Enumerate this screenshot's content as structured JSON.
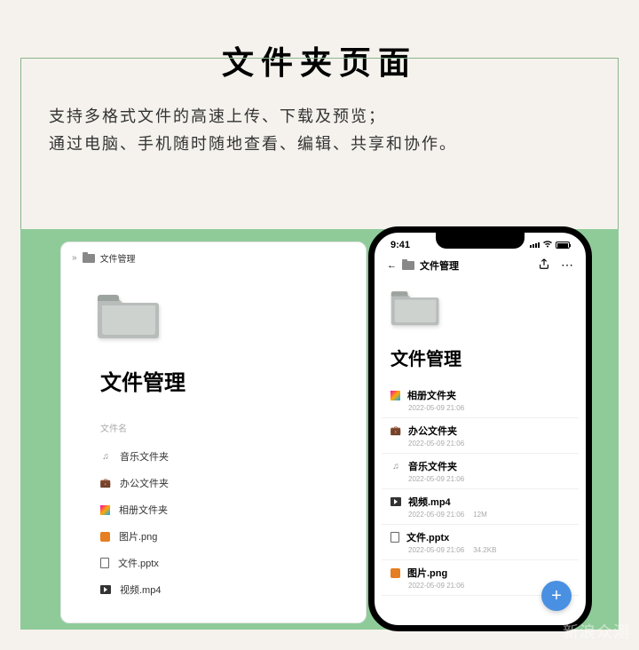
{
  "page_title": "文件夹页面",
  "subtitle_line1": "支持多格式文件的高速上传、下载及预览；",
  "subtitle_line2": "通过电脑、手机随时随地查看、编辑、共享和协作。",
  "desktop": {
    "breadcrumb_icon": "folder",
    "breadcrumb": "文件管理",
    "title": "文件管理",
    "column_header": "文件名",
    "items": [
      {
        "icon": "music",
        "name": "音乐文件夹"
      },
      {
        "icon": "briefcase",
        "name": "办公文件夹"
      },
      {
        "icon": "album",
        "name": "相册文件夹"
      },
      {
        "icon": "img",
        "name": "图片.png"
      },
      {
        "icon": "file",
        "name": "文件.pptx"
      },
      {
        "icon": "video",
        "name": "视频.mp4"
      }
    ]
  },
  "phone": {
    "status_time": "9:41",
    "breadcrumb": "文件管理",
    "title": "文件管理",
    "items": [
      {
        "icon": "album",
        "name": "相册文件夹",
        "date": "2022-05-09 21:06",
        "size": ""
      },
      {
        "icon": "briefcase",
        "name": "办公文件夹",
        "date": "2022-05-09 21:06",
        "size": ""
      },
      {
        "icon": "music",
        "name": "音乐文件夹",
        "date": "2022-05-09 21:06",
        "size": ""
      },
      {
        "icon": "video",
        "name": "视频.mp4",
        "date": "2022-05-09 21:06",
        "size": "12M"
      },
      {
        "icon": "file",
        "name": "文件.pptx",
        "date": "2022-05-09 21:06",
        "size": "34.2KB"
      },
      {
        "icon": "img",
        "name": "图片.png",
        "date": "2022-05-09 21:06",
        "size": ""
      }
    ],
    "fab_label": "+"
  },
  "watermark": "新浪众测"
}
